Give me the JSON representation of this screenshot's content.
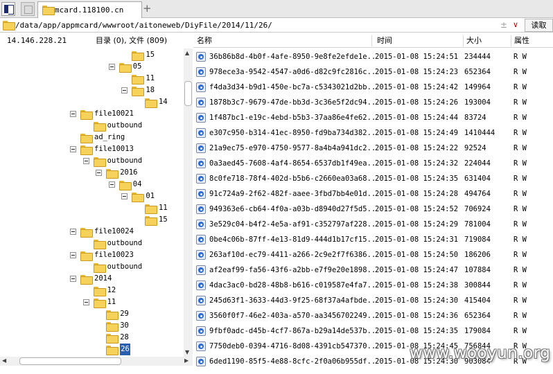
{
  "tab": {
    "title": "mcard.118100.cn",
    "add_label": "+"
  },
  "path": {
    "value": "/data/app/appmcard/wwwroot/aitoneweb/DiyFile/2014/11/26/",
    "aux_glyph": "±",
    "dropdown_glyph": "∨",
    "read_label": "读取"
  },
  "header": {
    "ip": "14.146.228.21",
    "count": "目录 (0), 文件 (809)"
  },
  "columns": {
    "name": "名称",
    "time": "时间",
    "size": "大小",
    "attr": "属性"
  },
  "tree": [
    {
      "label": "15",
      "level": 5,
      "expander": false,
      "selected": false
    },
    {
      "label": "05",
      "level": 4,
      "expander": true,
      "selected": false
    },
    {
      "label": "11",
      "level": 5,
      "expander": false,
      "selected": false
    },
    {
      "label": "18",
      "level": 5,
      "expander": true,
      "selected": false
    },
    {
      "label": "14",
      "level": 6,
      "expander": false,
      "selected": false
    },
    {
      "label": "file10021",
      "level": 1,
      "expander": true,
      "selected": false
    },
    {
      "label": "outbound",
      "level": 2,
      "expander": false,
      "selected": false
    },
    {
      "label": "ad_ring",
      "level": 1,
      "expander": false,
      "selected": false
    },
    {
      "label": "file10013",
      "level": 1,
      "expander": true,
      "selected": false
    },
    {
      "label": "outbound",
      "level": 2,
      "expander": true,
      "selected": false
    },
    {
      "label": "2016",
      "level": 3,
      "expander": true,
      "selected": false
    },
    {
      "label": "04",
      "level": 4,
      "expander": true,
      "selected": false
    },
    {
      "label": "01",
      "level": 5,
      "expander": true,
      "selected": false
    },
    {
      "label": "11",
      "level": 6,
      "expander": false,
      "selected": false
    },
    {
      "label": "15",
      "level": 6,
      "expander": false,
      "selected": false
    },
    {
      "label": "file10024",
      "level": 1,
      "expander": true,
      "selected": false
    },
    {
      "label": "outbound",
      "level": 2,
      "expander": false,
      "selected": false
    },
    {
      "label": "file10023",
      "level": 1,
      "expander": true,
      "selected": false
    },
    {
      "label": "outbound",
      "level": 2,
      "expander": false,
      "selected": false
    },
    {
      "label": "2014",
      "level": 1,
      "expander": true,
      "selected": false
    },
    {
      "label": "12",
      "level": 2,
      "expander": false,
      "selected": false
    },
    {
      "label": "11",
      "level": 2,
      "expander": true,
      "selected": false
    },
    {
      "label": "29",
      "level": 3,
      "expander": false,
      "selected": false
    },
    {
      "label": "30",
      "level": 3,
      "expander": false,
      "selected": false
    },
    {
      "label": "28",
      "level": 3,
      "expander": false,
      "selected": false
    },
    {
      "label": "26",
      "level": 3,
      "expander": false,
      "selected": true
    }
  ],
  "files": [
    {
      "name": "36b86b8d-4b0f-4afe-8950-9e8fe2efde1e...",
      "time": "2015-01-08 15:24:51",
      "size": "234444",
      "attr": "R W"
    },
    {
      "name": "978ece3a-9542-4547-a0d6-d82c9fc2816c...",
      "time": "2015-01-08 15:24:23",
      "size": "652364",
      "attr": "R W"
    },
    {
      "name": "f4da3d34-b9d1-450e-bc7a-c5343021d2bb...",
      "time": "2015-01-08 15:24:42",
      "size": "149964",
      "attr": "R W"
    },
    {
      "name": "1878b3c7-9679-47de-bb3d-3c36e5f2dc94...",
      "time": "2015-01-08 15:24:26",
      "size": "193004",
      "attr": "R W"
    },
    {
      "name": "1f487bc1-e19c-4ebd-b5b3-37aa86e4fe62...",
      "time": "2015-01-08 15:24:44",
      "size": "83724",
      "attr": "R W"
    },
    {
      "name": "e307c950-b314-41ec-8950-fd9ba734d382...",
      "time": "2015-01-08 15:24:49",
      "size": "1410444",
      "attr": "R W"
    },
    {
      "name": "21a9ec75-e970-4750-9577-8a4b4a941dc2...",
      "time": "2015-01-08 15:24:22",
      "size": "92524",
      "attr": "R W"
    },
    {
      "name": "0a3aed45-7608-4af4-8654-6537db1f49ea...",
      "time": "2015-01-08 15:24:32",
      "size": "224044",
      "attr": "R W"
    },
    {
      "name": "8c0fe718-78f4-402d-b5b6-c2660ea03a68...",
      "time": "2015-01-08 15:24:35",
      "size": "631404",
      "attr": "R W"
    },
    {
      "name": "91c724a9-2f62-482f-aaee-3fbd7bb4e01d...",
      "time": "2015-01-08 15:24:28",
      "size": "494764",
      "attr": "R W"
    },
    {
      "name": "949363e6-cb64-4f0a-a03b-d8940d27f5d5...",
      "time": "2015-01-08 15:24:52",
      "size": "706924",
      "attr": "R W"
    },
    {
      "name": "3e529c04-b4f2-4e5a-af91-c352797af228...",
      "time": "2015-01-08 15:24:29",
      "size": "781004",
      "attr": "R W"
    },
    {
      "name": "0be4c06b-87ff-4e13-81d9-444d1b17cf15...",
      "time": "2015-01-08 15:24:31",
      "size": "719084",
      "attr": "R W"
    },
    {
      "name": "263af10d-ec79-4411-a266-2c9e2f7f6386...",
      "time": "2015-01-08 15:24:50",
      "size": "186206",
      "attr": "R W"
    },
    {
      "name": "af2eaf99-fa56-43f6-a2bb-e7f9e20e1898...",
      "time": "2015-01-08 15:24:47",
      "size": "107884",
      "attr": "R W"
    },
    {
      "name": "4dac3ac0-bd28-48b8-b616-c019587e4fa7...",
      "time": "2015-01-08 15:24:38",
      "size": "300844",
      "attr": "R W"
    },
    {
      "name": "245d63f1-3633-44d3-9f25-68f37a4afbde...",
      "time": "2015-01-08 15:24:30",
      "size": "415404",
      "attr": "R W"
    },
    {
      "name": "3560f0f7-46e2-403a-a570-aa3456702249...",
      "time": "2015-01-08 15:24:36",
      "size": "652364",
      "attr": "R W"
    },
    {
      "name": "9fbf0adc-d45b-4cf7-867a-b29a14de537b...",
      "time": "2015-01-08 15:24:35",
      "size": "179084",
      "attr": "R W"
    },
    {
      "name": "7750deb0-0394-4716-8d08-4391cb547370...",
      "time": "2015-01-08 15:24:45",
      "size": "756844",
      "attr": "R W"
    },
    {
      "name": "6ded1190-85f5-4e88-8cfc-2f0a06b955df...",
      "time": "2015-01-08 15:24:30",
      "size": "903084",
      "attr": "R W"
    }
  ],
  "watermark": "www.wooyun.org"
}
